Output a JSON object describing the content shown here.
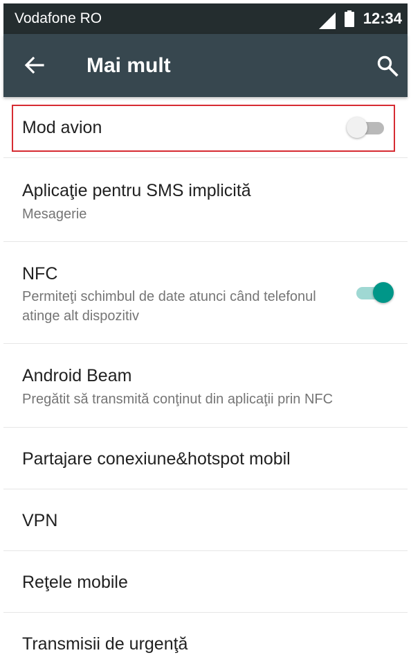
{
  "status_bar": {
    "carrier": "Vodafone RO",
    "time": "12:34",
    "signal_icon": "cell-signal-icon",
    "battery_icon": "battery-icon"
  },
  "toolbar": {
    "title": "Mai mult",
    "back_icon": "arrow-left-icon",
    "search_icon": "search-icon"
  },
  "settings": {
    "airplane_mode": {
      "title": "Mod avion",
      "enabled": false,
      "highlighted": true
    },
    "default_sms": {
      "title": "Aplicaţie pentru SMS implicită",
      "summary": "Mesagerie"
    },
    "nfc": {
      "title": "NFC",
      "summary": "Permiteţi schimbul de date atunci când telefonul atinge alt dispozitiv",
      "enabled": true
    },
    "android_beam": {
      "title": "Android Beam",
      "summary": "Pregătit să transmită conţinut din aplicaţii prin NFC"
    },
    "tethering": {
      "title": "Partajare conexiune&hotspot mobil"
    },
    "vpn": {
      "title": "VPN"
    },
    "mobile_networks": {
      "title": "Reţele mobile"
    },
    "emergency_broadcasts": {
      "title": "Transmisii de urgenţă"
    }
  },
  "colors": {
    "status_bar": "#242d2f",
    "toolbar": "#37474f",
    "accent": "#009688",
    "accent_track": "#9fd8d3",
    "highlight_border": "#d62b32",
    "switch_off_track": "#b9b9b9",
    "switch_off_thumb": "#f1f1f1",
    "primary_text": "#212121",
    "secondary_text": "#757575"
  }
}
